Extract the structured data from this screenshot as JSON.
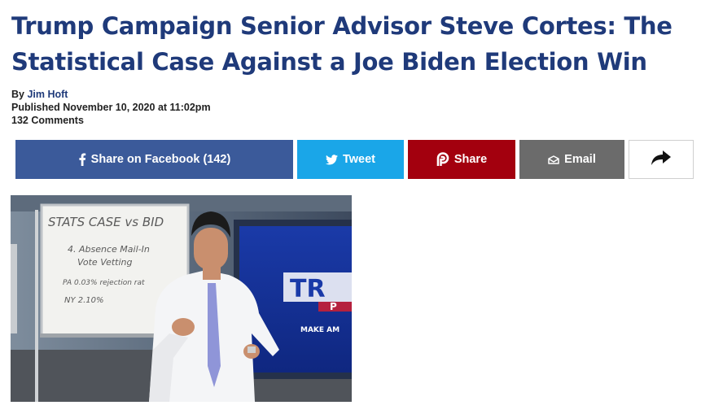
{
  "article": {
    "title": "Trump Campaign Senior Advisor Steve Cortes: The Statistical Case Against a Joe Biden Election Win",
    "by_prefix": "By",
    "author": "Jim Hoft",
    "published": "Published November 10, 2020 at 11:02pm",
    "comments": "132 Comments"
  },
  "share": {
    "facebook_label": "Share on Facebook (142)",
    "tweet_label": "Tweet",
    "parler_label": "Share",
    "email_label": "Email",
    "colors": {
      "facebook": "#3b5a9a",
      "twitter": "#1aa6e8",
      "parler": "#a3000e",
      "email": "#6b6b6b"
    }
  },
  "video": {
    "whiteboard": {
      "line1": "STATS CASE vs BID",
      "line2": "4. Absence Mail-In",
      "line3": "Vote Vetting",
      "line4": "PA 0.03% rejection rat",
      "line5": "NY 2.10%"
    },
    "screen_text": {
      "big": "TR",
      "mid": "P",
      "small": "MAKE AM"
    }
  },
  "icons": [
    "facebook-icon",
    "twitter-icon",
    "parler-icon",
    "envelope-icon",
    "share-arrow-icon"
  ]
}
